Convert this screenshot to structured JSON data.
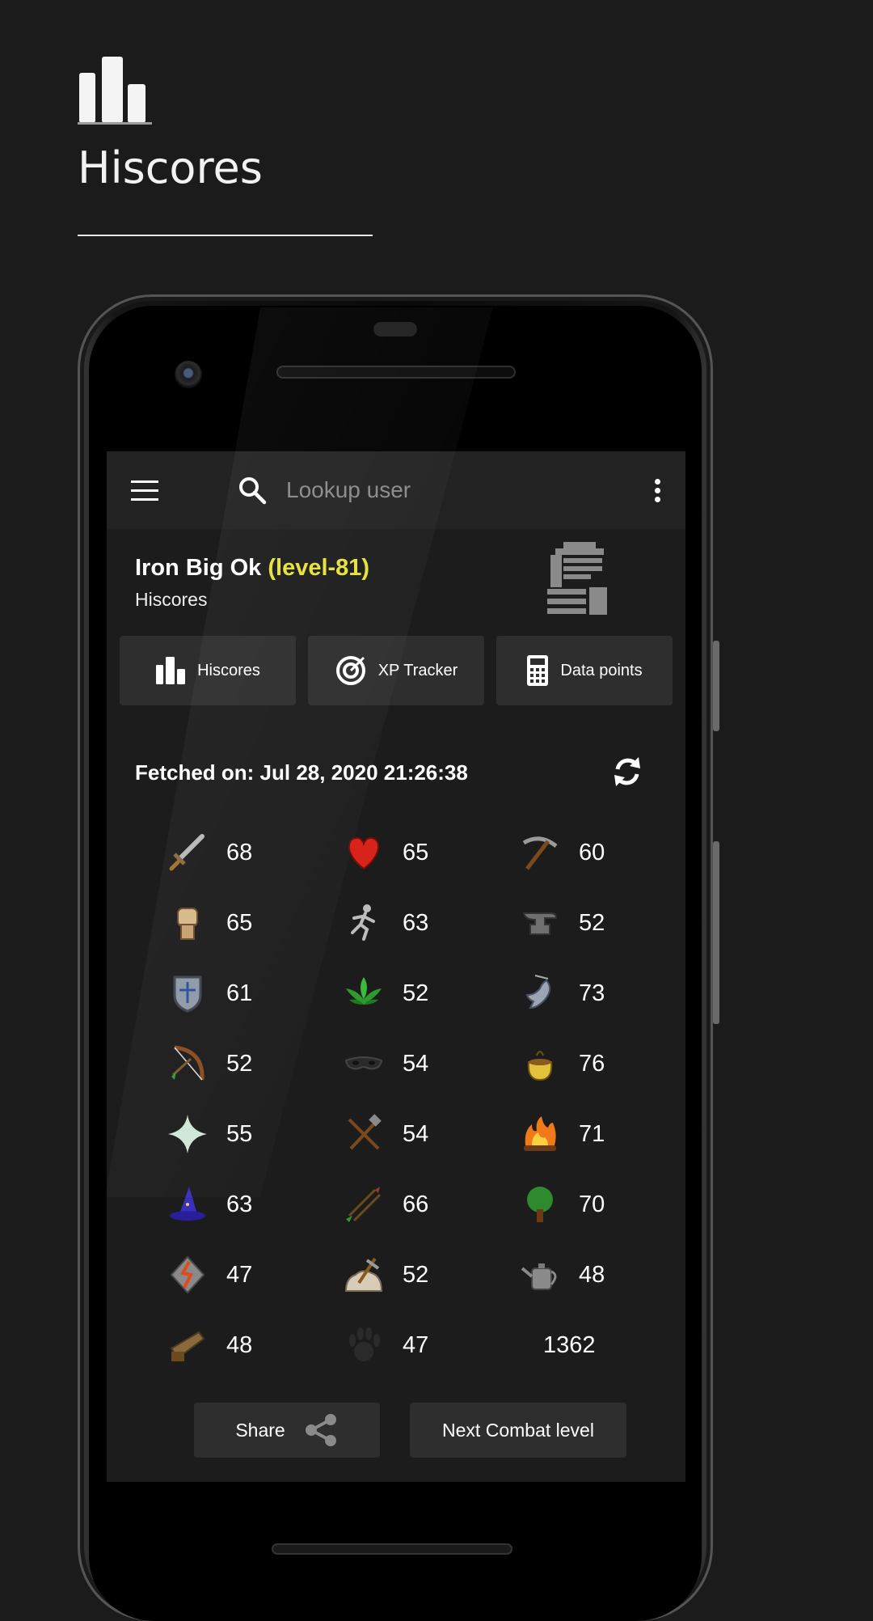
{
  "promo": {
    "title": "Hiscores"
  },
  "toolbar": {
    "search_placeholder": "Lookup user"
  },
  "user": {
    "name": "Iron Big Ok",
    "level": "(level-81)",
    "subtitle": "Hiscores"
  },
  "tabs": [
    {
      "label": "Hiscores",
      "icon": "bar-chart-icon"
    },
    {
      "label": "XP Tracker",
      "icon": "target-icon"
    },
    {
      "label": "Data points",
      "icon": "calculator-icon"
    }
  ],
  "fetched": "Fetched on: Jul 28, 2020 21:26:38",
  "skills": [
    {
      "icon": "sword-icon",
      "value": "68"
    },
    {
      "icon": "heart-icon",
      "value": "65"
    },
    {
      "icon": "pickaxe-icon",
      "value": "60"
    },
    {
      "icon": "fist-icon",
      "value": "65"
    },
    {
      "icon": "runner-icon",
      "value": "63"
    },
    {
      "icon": "anvil-icon",
      "value": "52"
    },
    {
      "icon": "shield-icon",
      "value": "61"
    },
    {
      "icon": "herb-icon",
      "value": "52"
    },
    {
      "icon": "fish-icon",
      "value": "73"
    },
    {
      "icon": "bow-icon",
      "value": "52"
    },
    {
      "icon": "mask-icon",
      "value": "54"
    },
    {
      "icon": "stew-icon",
      "value": "76"
    },
    {
      "icon": "star-icon",
      "value": "55"
    },
    {
      "icon": "hammer-chisel-icon",
      "value": "54"
    },
    {
      "icon": "fire-icon",
      "value": "71"
    },
    {
      "icon": "wizard-hat-icon",
      "value": "63"
    },
    {
      "icon": "arrows-icon",
      "value": "66"
    },
    {
      "icon": "tree-icon",
      "value": "70"
    },
    {
      "icon": "rune-icon",
      "value": "47"
    },
    {
      "icon": "mining-rock-icon",
      "value": "52"
    },
    {
      "icon": "watering-can-icon",
      "value": "48"
    },
    {
      "icon": "saw-icon",
      "value": "48"
    },
    {
      "icon": "paw-icon",
      "value": "47"
    }
  ],
  "total_level": "1362",
  "actions": {
    "share": "Share",
    "next_combat": "Next Combat level"
  },
  "colors": {
    "accent_level": "#e5e23a",
    "background": "#1b1b1b",
    "card": "#2e2e2e"
  }
}
